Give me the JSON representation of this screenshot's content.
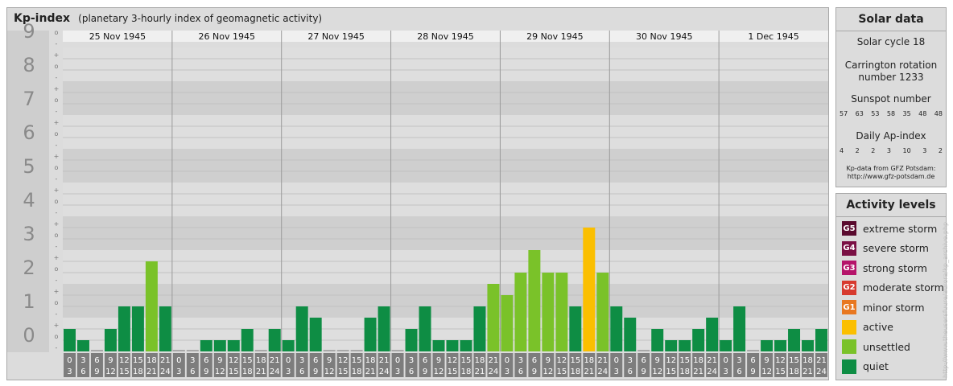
{
  "header": {
    "title": "Kp-index",
    "subtitle": "(planetary 3-hourly index of geomagnetic activity)"
  },
  "chart_data": {
    "type": "bar",
    "ylim": [
      0,
      9
    ],
    "y_ticks": [
      "0",
      "1",
      "2",
      "3",
      "4",
      "5",
      "6",
      "7",
      "8",
      "9"
    ],
    "y_minor_ticks": [
      "-",
      "o",
      "+"
    ],
    "days": [
      "25 Nov 1945",
      "26 Nov 1945",
      "27 Nov 1945",
      "28 Nov 1945",
      "29 Nov 1945",
      "30 Nov 1945",
      "1 Dec 1945"
    ],
    "hour_labels_start": [
      "0",
      "3",
      "6",
      "9",
      "12",
      "15",
      "18",
      "21"
    ],
    "hour_labels_end": [
      "3",
      "6",
      "9",
      "12",
      "15",
      "18",
      "21",
      "24"
    ],
    "values": [
      0.667,
      0.333,
      0.0,
      0.667,
      1.333,
      1.333,
      2.667,
      1.333,
      0.0,
      0.0,
      0.333,
      0.333,
      0.333,
      0.667,
      0.0,
      0.667,
      0.333,
      1.333,
      1.0,
      0.0,
      0.0,
      0.0,
      1.0,
      1.333,
      0.0,
      0.667,
      1.333,
      0.333,
      0.333,
      0.333,
      1.333,
      2.0,
      1.667,
      2.333,
      3.0,
      2.333,
      2.333,
      1.333,
      3.667,
      2.333,
      1.333,
      1.0,
      0.0,
      0.667,
      0.333,
      0.333,
      0.667,
      1.0,
      0.333,
      1.333,
      0.0,
      0.333,
      0.333,
      0.667,
      0.333,
      0.667
    ],
    "colors": {
      "quiet": "#0e8d44",
      "unsettled": "#7ac229",
      "active": "#fbbf00",
      "bar_min": "#a8a8a8"
    }
  },
  "solar": {
    "title": "Solar data",
    "cycle": "Solar cycle 18",
    "carrington_line1": "Carrington rotation",
    "carrington_line2": "number 1233",
    "sunspot_title": "Sunspot number",
    "sunspot_values": [
      "57",
      "63",
      "53",
      "58",
      "35",
      "48",
      "48"
    ],
    "ap_title": "Daily Ap-index",
    "ap_values": [
      "4",
      "2",
      "2",
      "3",
      "10",
      "3",
      "2"
    ],
    "credit_line1": "Kp-data from GFZ Potsdam:",
    "credit_line2": "http://www.gfz-potsdam.de"
  },
  "activity": {
    "title": "Activity levels",
    "items": [
      {
        "badge": "G5",
        "label": "extreme storm",
        "color": "#5a0a2e"
      },
      {
        "badge": "G4",
        "label": "severe storm",
        "color": "#7a1044"
      },
      {
        "badge": "G3",
        "label": "strong storm",
        "color": "#b5146a"
      },
      {
        "badge": "G2",
        "label": "moderate storm",
        "color": "#d73a2e"
      },
      {
        "badge": "G1",
        "label": "minor storm",
        "color": "#e8771f"
      },
      {
        "badge": "",
        "label": "active",
        "color": "#fbbf00"
      },
      {
        "badge": "",
        "label": "unsettled",
        "color": "#7ac229"
      },
      {
        "badge": "",
        "label": "quiet",
        "color": "#0e8d44"
      }
    ]
  },
  "watermark": "http://www.theusersfuure/aurora/kp_archive.php"
}
